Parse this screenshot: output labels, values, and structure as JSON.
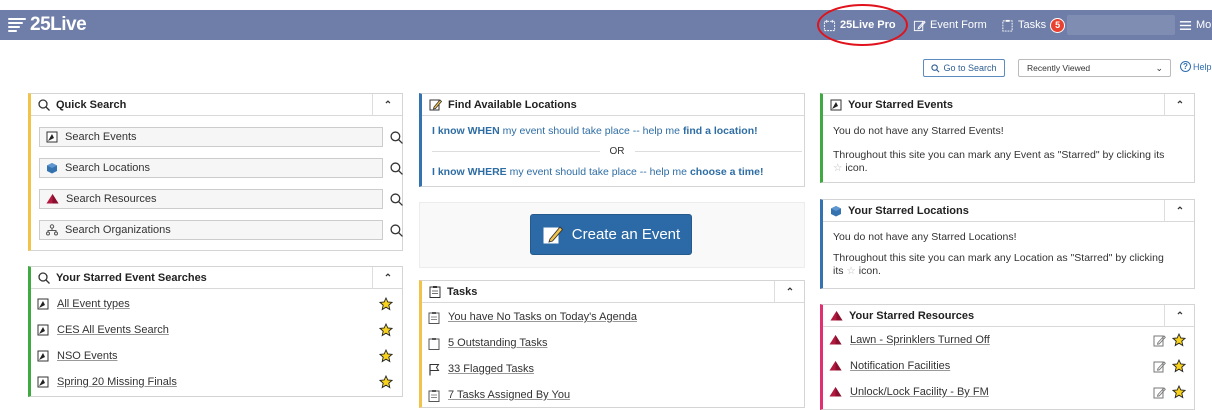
{
  "header": {
    "logo": "25Live",
    "nav": {
      "pro": "25Live Pro",
      "event_form": "Event Form",
      "tasks": "Tasks",
      "tasks_count": "5",
      "more": "More"
    }
  },
  "toolbar": {
    "go_to_search": "Go to Search",
    "recently_viewed": "Recently Viewed",
    "help": "Help"
  },
  "quick_search": {
    "title": "Quick Search",
    "items": [
      "Search Events",
      "Search Locations",
      "Search Resources",
      "Search Organizations"
    ]
  },
  "starred_searches": {
    "title": "Your Starred Event Searches",
    "items": [
      "All Event types",
      "CES All Events Search",
      "NSO Events",
      "Spring 20 Missing Finals"
    ]
  },
  "find_locations": {
    "title": "Find Available Locations",
    "when_prefix": "I know WHEN",
    "when_middle": " my event should take place -- help me ",
    "when_action": "find a location!",
    "or": "OR",
    "where_prefix": "I know WHERE",
    "where_middle": " my event should take place -- help me ",
    "where_action": "choose a time!"
  },
  "create_event": {
    "label": "Create an Event"
  },
  "tasks_panel": {
    "title": "Tasks",
    "items": [
      "You have No Tasks on Today's Agenda",
      "5 Outstanding Tasks",
      "33 Flagged Tasks",
      "7 Tasks Assigned By You"
    ]
  },
  "starred_events": {
    "title": "Your Starred Events",
    "msg1": "You do not have any Starred Events!",
    "msg2": "Throughout this site you can mark any Event as \"Starred\" by clicking its",
    "msg2_tail": "icon."
  },
  "starred_locations": {
    "title": "Your Starred Locations",
    "msg1": "You do not have any Starred Locations!",
    "msg2": "Throughout this site you can mark any Location as \"Starred\" by clicking",
    "msg2_tail_pre": "its",
    "msg2_tail": "icon."
  },
  "starred_resources": {
    "title": "Your Starred Resources",
    "items": [
      "Lawn - Sprinklers Turned Off",
      "Notification Facilities",
      "Unlock/Lock Facility - By FM"
    ]
  },
  "colors": {
    "topbar": "#6f7ea8",
    "accent_blue": "#2b6aa6",
    "yellow_border": "#f2c34a",
    "green_border": "#3faa3f",
    "pink_border": "#e0306f",
    "badge_red": "#e8412f",
    "annotation_red": "#e0121c"
  }
}
